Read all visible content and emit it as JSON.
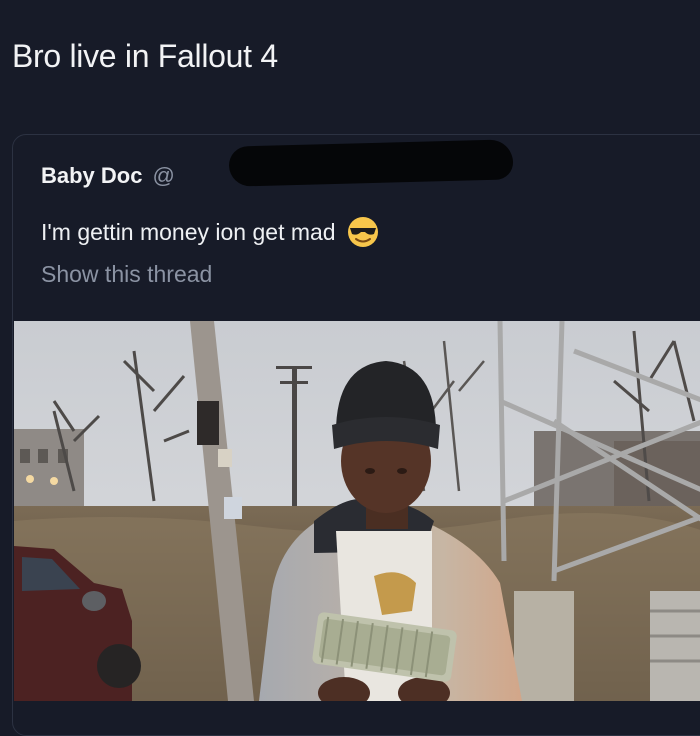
{
  "post": {
    "caption": "Bro live in Fallout 4"
  },
  "quoted_tweet": {
    "author_name": "Baby Doc",
    "author_handle": "@",
    "text": "I'm gettin money ion get mad",
    "emoji": "smiling-face-with-sunglasses",
    "show_thread": "Show this thread"
  },
  "colors": {
    "background": "#171b28",
    "secondary_text": "#8b93a3",
    "card_border": "#2c3242"
  }
}
